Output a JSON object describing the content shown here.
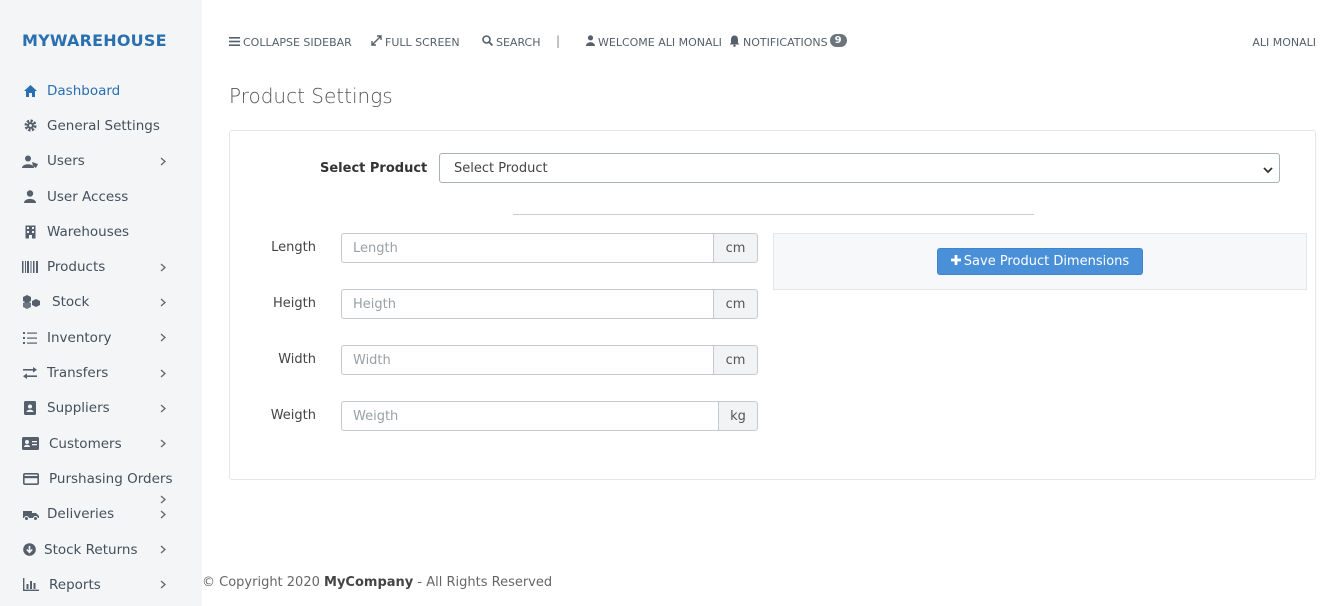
{
  "brand": "MYWAREHOUSE",
  "sidebar": {
    "items": [
      {
        "label": "Dashboard",
        "icon": "home-icon",
        "active": true
      },
      {
        "label": "General Settings",
        "icon": "gear-icon"
      },
      {
        "label": "Users",
        "icon": "users-icon",
        "chevron": true
      },
      {
        "label": "User Access",
        "icon": "user-icon"
      },
      {
        "label": "Warehouses",
        "icon": "building-icon"
      },
      {
        "label": "Products",
        "icon": "barcode-icon",
        "chevron": true
      },
      {
        "label": "Stock",
        "icon": "cubes-icon",
        "chevron": true
      },
      {
        "label": "Inventory",
        "icon": "list-icon",
        "chevron": true
      },
      {
        "label": "Transfers",
        "icon": "exchange-icon",
        "chevron": true
      },
      {
        "label": "Suppliers",
        "icon": "address-book-icon",
        "chevron": true
      },
      {
        "label": "Customers",
        "icon": "id-card-icon",
        "chevron": true
      },
      {
        "label": "Purshasing Orders",
        "icon": "credit-card-icon",
        "chevron": true
      },
      {
        "label": "Deliveries",
        "icon": "truck-icon",
        "chevron": true
      },
      {
        "label": "Stock Returns",
        "icon": "arrow-circle-down-icon",
        "chevron": true
      },
      {
        "label": "Reports",
        "icon": "bar-chart-icon",
        "chevron": true
      }
    ]
  },
  "topbar": {
    "collapse": "COLLAPSE SIDEBAR",
    "fullscreen": "FULL SCREEN",
    "search": "SEARCH",
    "separator": "|",
    "welcome": "WELCOME ALI MONALI",
    "notifications": "NOTIFICATIONS",
    "notification_count": "9",
    "user": "ALI MONALI"
  },
  "page": {
    "title": "Product Settings"
  },
  "form": {
    "select_label": "Select Product",
    "select_value": "Select Product",
    "fields": [
      {
        "label": "Length",
        "placeholder": "Length",
        "unit": "cm"
      },
      {
        "label": "Heigth",
        "placeholder": "Heigth",
        "unit": "cm"
      },
      {
        "label": "Width",
        "placeholder": "Width",
        "unit": "cm"
      },
      {
        "label": "Weigth",
        "placeholder": "Weigth",
        "unit": "kg"
      }
    ],
    "save_label": "Save Product Dimensions"
  },
  "footer": {
    "prefix": "© Copyright 2020",
    "company": "MyCompany",
    "suffix": "- All Rights Reserved"
  },
  "colors": {
    "accent": "#2a6fb0",
    "button": "#4a90d9",
    "sidebar_bg": "#f4f5f7"
  }
}
